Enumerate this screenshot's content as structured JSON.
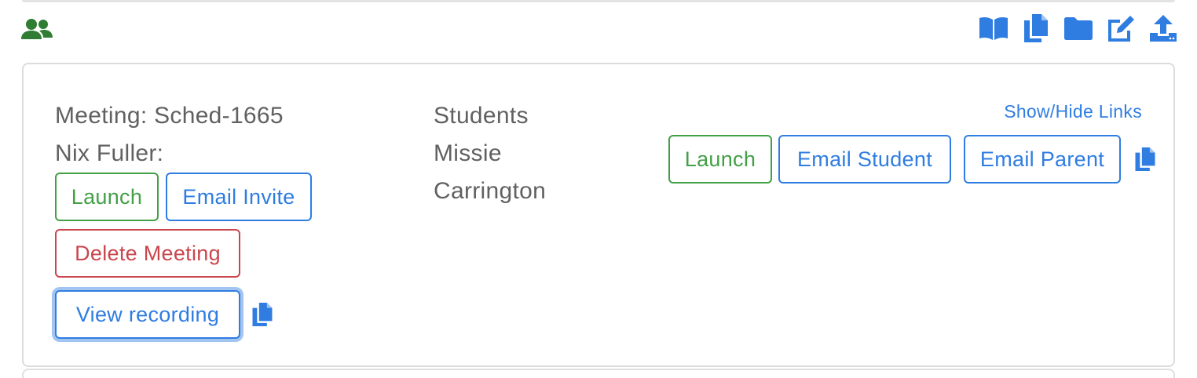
{
  "header": {
    "group_icon": "users-icon",
    "toolbar": [
      {
        "icon": "book-open-icon",
        "name": "toolbar-book-button"
      },
      {
        "icon": "copy-icon",
        "name": "toolbar-copy-button"
      },
      {
        "icon": "folder-icon",
        "name": "toolbar-folder-button"
      },
      {
        "icon": "edit-icon",
        "name": "toolbar-edit-button"
      },
      {
        "icon": "upload-icon",
        "name": "toolbar-upload-button"
      }
    ]
  },
  "meeting": {
    "title": "Meeting: Sched-1665",
    "host": "Nix Fuller:",
    "launch_label": "Launch",
    "email_invite_label": "Email Invite",
    "delete_label": "Delete Meeting",
    "view_recording_label": "View recording"
  },
  "students": {
    "heading": "Students",
    "first_name": "Missie",
    "last_name": "Carrington",
    "show_hide_links": "Show/Hide Links",
    "launch_label": "Launch",
    "email_student_label": "Email Student",
    "email_parent_label": "Email Parent"
  },
  "colors": {
    "green": "#43a047",
    "blue": "#2f7de1",
    "red": "#c9464d",
    "text": "#616161",
    "icon_green": "#2e7d32"
  }
}
